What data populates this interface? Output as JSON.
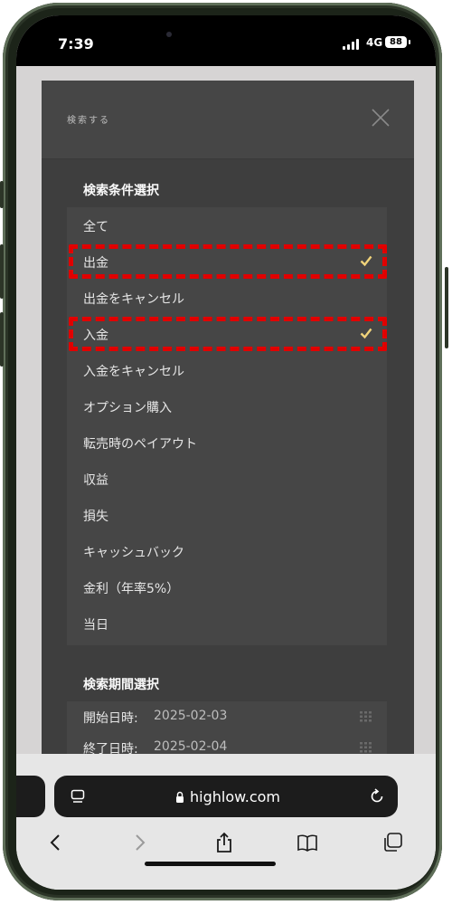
{
  "status_bar": {
    "time": "7:39",
    "network": "4G",
    "battery": "88"
  },
  "modal": {
    "title": "検索する",
    "condition_section_title": "検索条件選択",
    "condition_items": [
      {
        "label": "全て",
        "checked": false
      },
      {
        "label": "出金",
        "checked": true
      },
      {
        "label": "出金をキャンセル",
        "checked": false
      },
      {
        "label": "入金",
        "checked": true
      },
      {
        "label": "入金をキャンセル",
        "checked": false
      },
      {
        "label": "オプション購入",
        "checked": false
      },
      {
        "label": "転売時のペイアウト",
        "checked": false
      },
      {
        "label": "収益",
        "checked": false
      },
      {
        "label": "損失",
        "checked": false
      },
      {
        "label": "キャッシュバック",
        "checked": false
      },
      {
        "label": "金利（年率5%）",
        "checked": false
      },
      {
        "label": "当日",
        "checked": false
      }
    ],
    "period_section_title": "検索期間選択",
    "start_label": "開始日時:",
    "start_value": "2025-02-03",
    "end_label": "終了日時:",
    "end_value": "2025-02-04"
  },
  "browser": {
    "url": "highlow.com"
  },
  "colors": {
    "highlight": "#e10000",
    "check": "#f0d37a",
    "modal_bg": "#3e3e3e",
    "phone_frame": "#5f6f59"
  }
}
